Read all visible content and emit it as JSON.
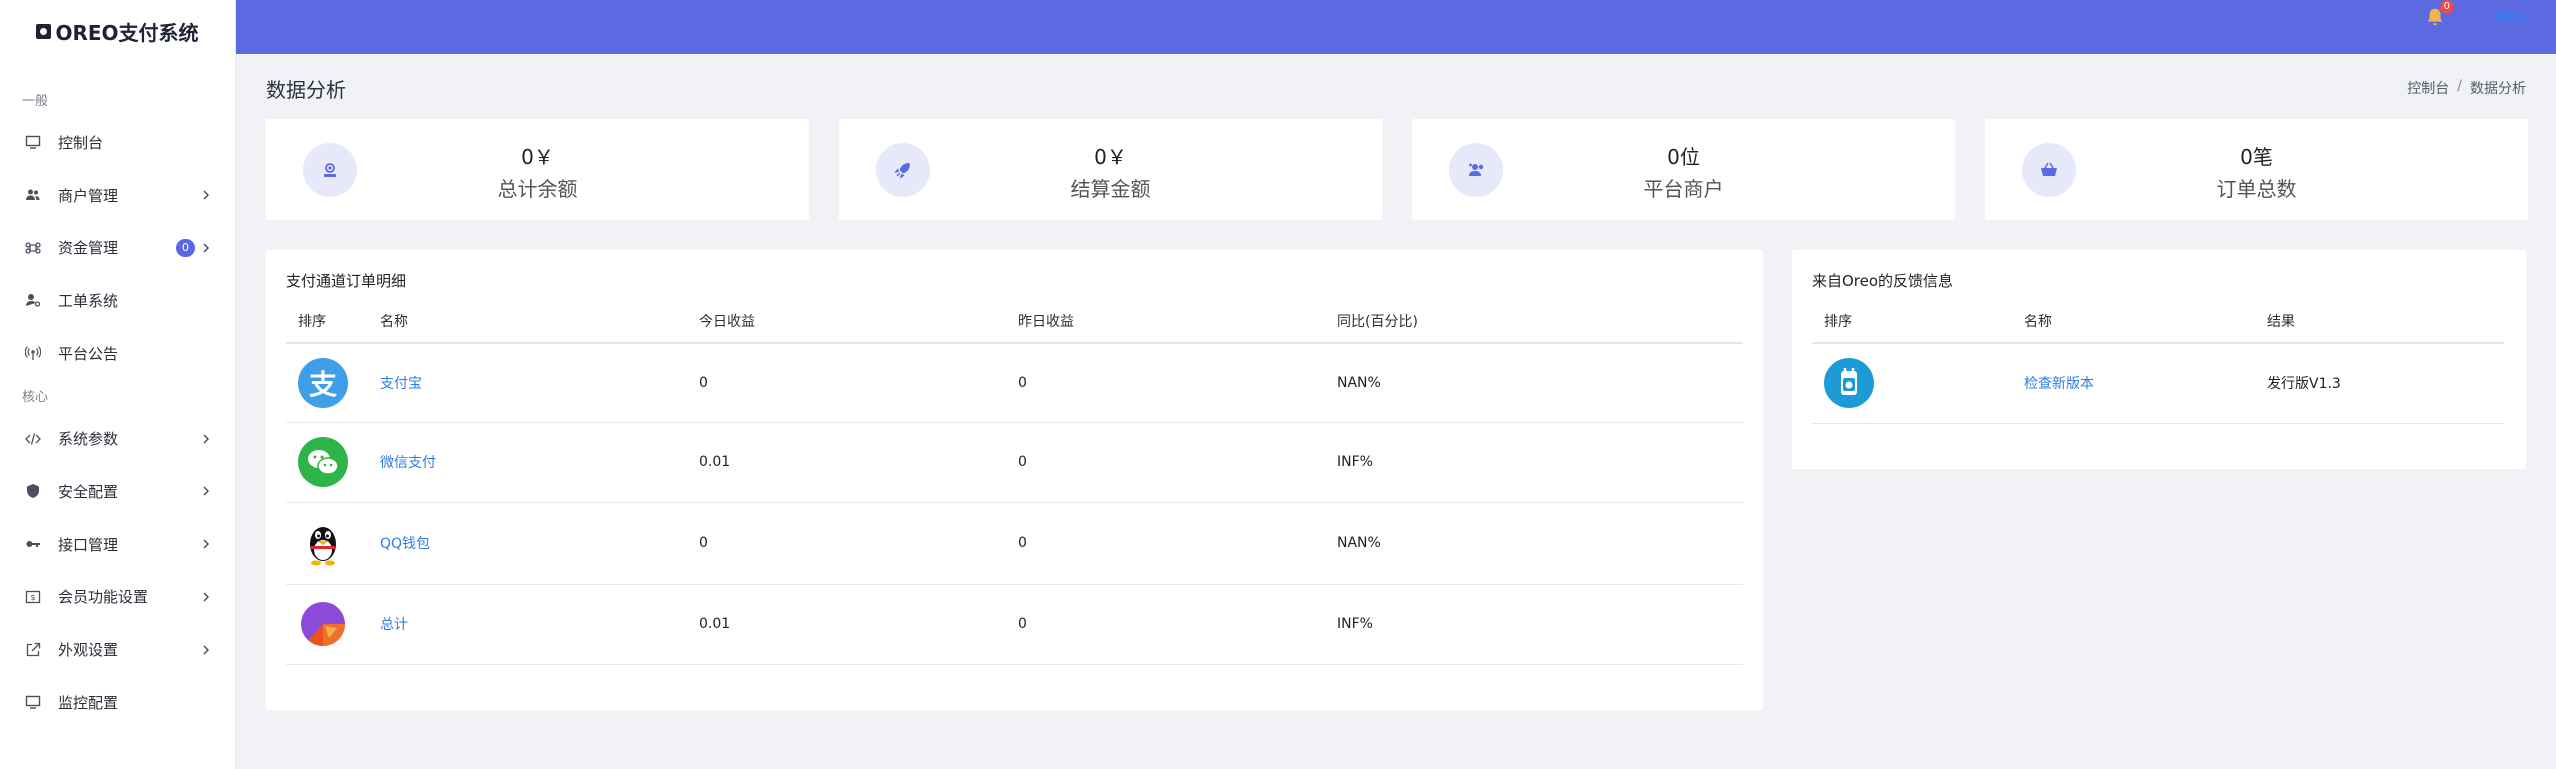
{
  "brand": {
    "name": "OREO支付系统"
  },
  "sidebar": {
    "sections": [
      "一般",
      "核心"
    ],
    "items": [
      {
        "label": "控制台"
      },
      {
        "label": "商户管理"
      },
      {
        "label": "资金管理",
        "badge": "0"
      },
      {
        "label": "工单系统"
      },
      {
        "label": "平台公告"
      },
      {
        "label": "系统参数"
      },
      {
        "label": "安全配置"
      },
      {
        "label": "接口管理"
      },
      {
        "label": "会员功能设置"
      },
      {
        "label": "外观设置"
      },
      {
        "label": "监控配置"
      }
    ]
  },
  "topbar": {
    "notification_count": "0",
    "user_link": "Oreo"
  },
  "page": {
    "title": "数据分析",
    "breadcrumb": [
      "控制台",
      "/",
      "数据分析"
    ]
  },
  "stats": [
    {
      "value": "0￥",
      "label": "总计余额",
      "icon": "wallet-icon"
    },
    {
      "value": "0￥",
      "label": "结算金额",
      "icon": "rocket-icon"
    },
    {
      "value": "0位",
      "label": "平台商户",
      "icon": "users-add-icon"
    },
    {
      "value": "0笔",
      "label": "订单总数",
      "icon": "basket-icon"
    }
  ],
  "orders_panel": {
    "title": "支付通道订单明细",
    "headers": [
      "排序",
      "名称",
      "今日收益",
      "昨日收益",
      "同比(百分比)"
    ],
    "rows": [
      {
        "name": "支付宝",
        "today": "0",
        "yesterday": "0",
        "ratio": "NAN%",
        "icon": "alipay-icon"
      },
      {
        "name": "微信支付",
        "today": "0.01",
        "yesterday": "0",
        "ratio": "INF%",
        "icon": "wechat-icon"
      },
      {
        "name": "QQ钱包",
        "today": "0",
        "yesterday": "0",
        "ratio": "NAN%",
        "icon": "qq-icon"
      },
      {
        "name": "总计",
        "today": "0.01",
        "yesterday": "0",
        "ratio": "INF%",
        "icon": "pie-chart-icon"
      }
    ]
  },
  "feedback_panel": {
    "title": "来自Oreo的反馈信息",
    "headers": [
      "排序",
      "名称",
      "结果"
    ],
    "rows": [
      {
        "name": "检查新版本",
        "result": "发行版V1.3",
        "icon": "update-icon"
      }
    ]
  },
  "colors": {
    "topbar": "#5b6ae0",
    "link": "#2e7de6",
    "badge": "#5a67e3"
  }
}
